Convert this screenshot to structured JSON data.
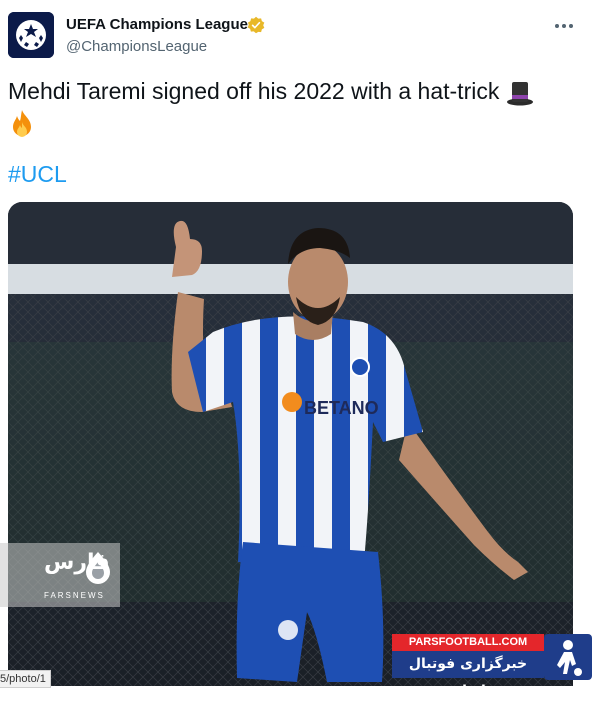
{
  "tweet": {
    "author_name": "UEFA Champions League",
    "author_handle": "@ChampionsLeague",
    "text": "Mehdi Taremi signed off his 2022 with a hat-trick",
    "emoji_names": [
      "top-hat",
      "fire"
    ],
    "hashtag": "#UCL"
  },
  "media": {
    "sponsor_text": "BETANO",
    "watermark_farsnews": {
      "title": "فارس",
      "latin": "FARSNEWS"
    },
    "watermark_parsfootball": {
      "top": "PARSFOOTBALL.COM",
      "bottom": "خبرگزاری فوتبال ایران"
    }
  },
  "url_fragment": "5/photo/1",
  "colors": {
    "link": "#1d9bf0",
    "verified": "#e8b829",
    "ucl_navy": "#0b1a49",
    "porto_blue": "#1e4fb3"
  }
}
